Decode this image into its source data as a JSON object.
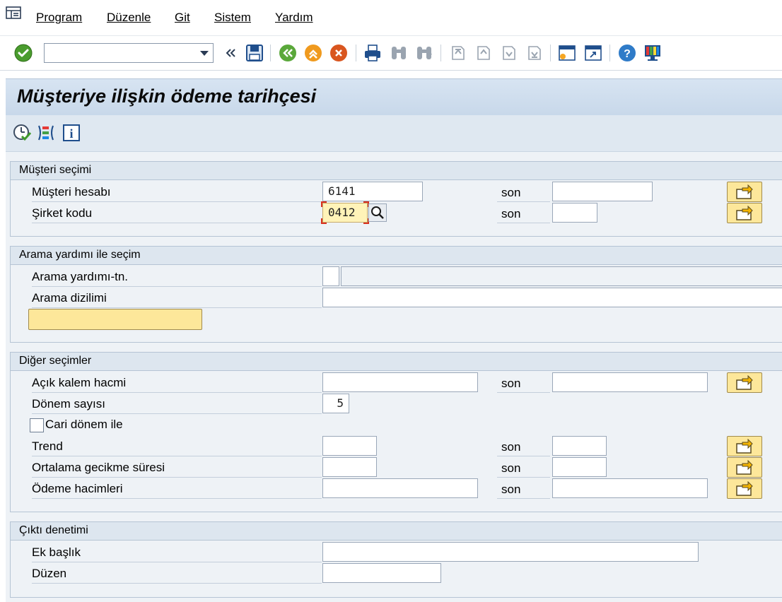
{
  "menu": {
    "items": [
      {
        "label": "Program"
      },
      {
        "label": "Düzenle"
      },
      {
        "label": "Git"
      },
      {
        "label": "Sistem"
      },
      {
        "label": "Yardım"
      }
    ]
  },
  "toolbar": {
    "command_value": "",
    "icons": [
      "enter-check-icon",
      "command-dropdown-icon",
      "history-back-icon",
      "save-icon",
      "back-icon",
      "exit-icon",
      "cancel-icon",
      "print-icon",
      "find-icon",
      "find-next-icon",
      "first-page-icon",
      "previous-page-icon",
      "next-page-icon",
      "last-page-icon",
      "new-session-icon",
      "shortcut-icon",
      "help-icon",
      "customize-layout-icon"
    ]
  },
  "title": "Müşteriye ilişkin ödeme tarihçesi",
  "sub_toolbar": {
    "icons": [
      "execute-icon",
      "get-variant-icon",
      "info-icon"
    ]
  },
  "groups": {
    "customer": {
      "title": "Müşteri seçimi",
      "rows": [
        {
          "label": "Müşteri hesabı",
          "value": "6141",
          "to_label": "son",
          "to_value": ""
        },
        {
          "label": "Şirket kodu",
          "value": "0412",
          "to_label": "son",
          "to_value": ""
        }
      ]
    },
    "search_help": {
      "title": "Arama yardımı ile seçim",
      "rows": [
        {
          "label": "Arama yardımı-tn.",
          "value": "",
          "desc": ""
        },
        {
          "label": "Arama dizilimi",
          "value": ""
        }
      ],
      "button_label": ""
    },
    "other": {
      "title": "Diğer seçimler",
      "rows": [
        {
          "label": "Açık kalem hacmi",
          "value": "",
          "to_label": "son",
          "to_value": ""
        },
        {
          "label": "Dönem sayısı",
          "value": "5"
        },
        {
          "label": "Cari dönem ile",
          "checked": false
        },
        {
          "label": "Trend",
          "value": "",
          "to_label": "son",
          "to_value": ""
        },
        {
          "label": "Ortalama gecikme süresi",
          "value": "",
          "to_label": "son",
          "to_value": ""
        },
        {
          "label": "Ödeme hacimleri",
          "value": "",
          "to_label": "son",
          "to_value": ""
        }
      ]
    },
    "output": {
      "title": "Çıktı denetimi",
      "rows": [
        {
          "label": "Ek başlık",
          "value": ""
        },
        {
          "label": "Düzen",
          "value": ""
        }
      ]
    }
  },
  "colors": {
    "accent_yellow": "#fde79a",
    "title_bg": "#c8d8ea",
    "content_bg": "#eef2f6",
    "focus_red": "#d9301f"
  }
}
